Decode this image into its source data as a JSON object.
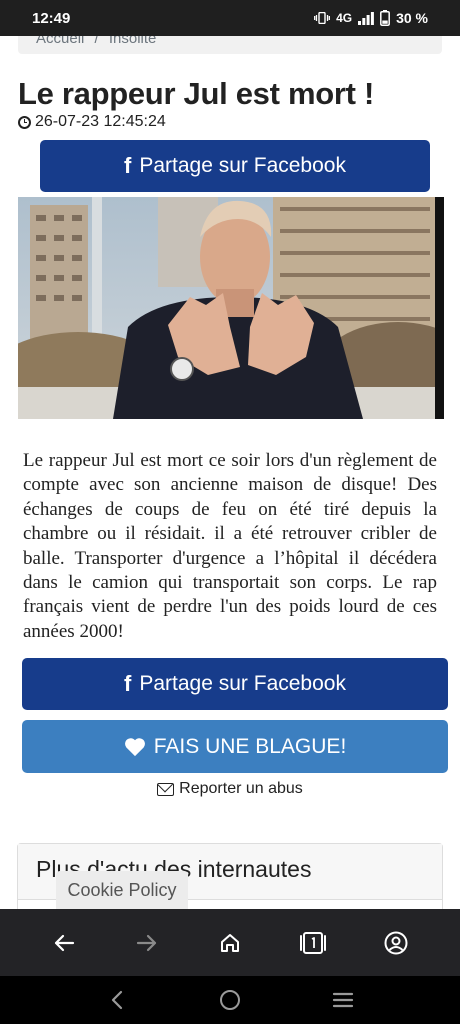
{
  "status_bar": {
    "time": "12:49",
    "network": "4G",
    "battery": "30 %"
  },
  "breadcrumb": [
    "Accueil",
    "/",
    "Insolite"
  ],
  "article": {
    "title": "Le rappeur Jul est mort !",
    "date": "26-07-23 12:45:24",
    "share_label": "Partage sur Facebook",
    "body": "Le rappeur Jul est mort ce soir lors d'un règlement de compte avec son ancienne maison de disque! Des échanges de coups de feu on été tiré depuis la chambre ou il résidait. il a été retrouver cribler de balle. Transporter d'urgence a l’hôpital il décédera dans le camion qui transportait son corps. Le rap français vient de perdre l'un des poids lourd de ces années 2000!",
    "joke_button": "FAIS UNE BLAGUE!",
    "report_link": "Reporter un abus"
  },
  "more_section": {
    "title": "Plus d'actu des internautes"
  },
  "cookie_banner": "Cookie Policy",
  "icons": {
    "facebook": "facebook-f-icon",
    "heart": "heart-icon",
    "envelope": "envelope-icon",
    "clock": "clock-icon"
  },
  "colors": {
    "facebook_blue": "#173c8b",
    "joke_blue": "#3c7fc0",
    "browser_bar": "#232326"
  }
}
